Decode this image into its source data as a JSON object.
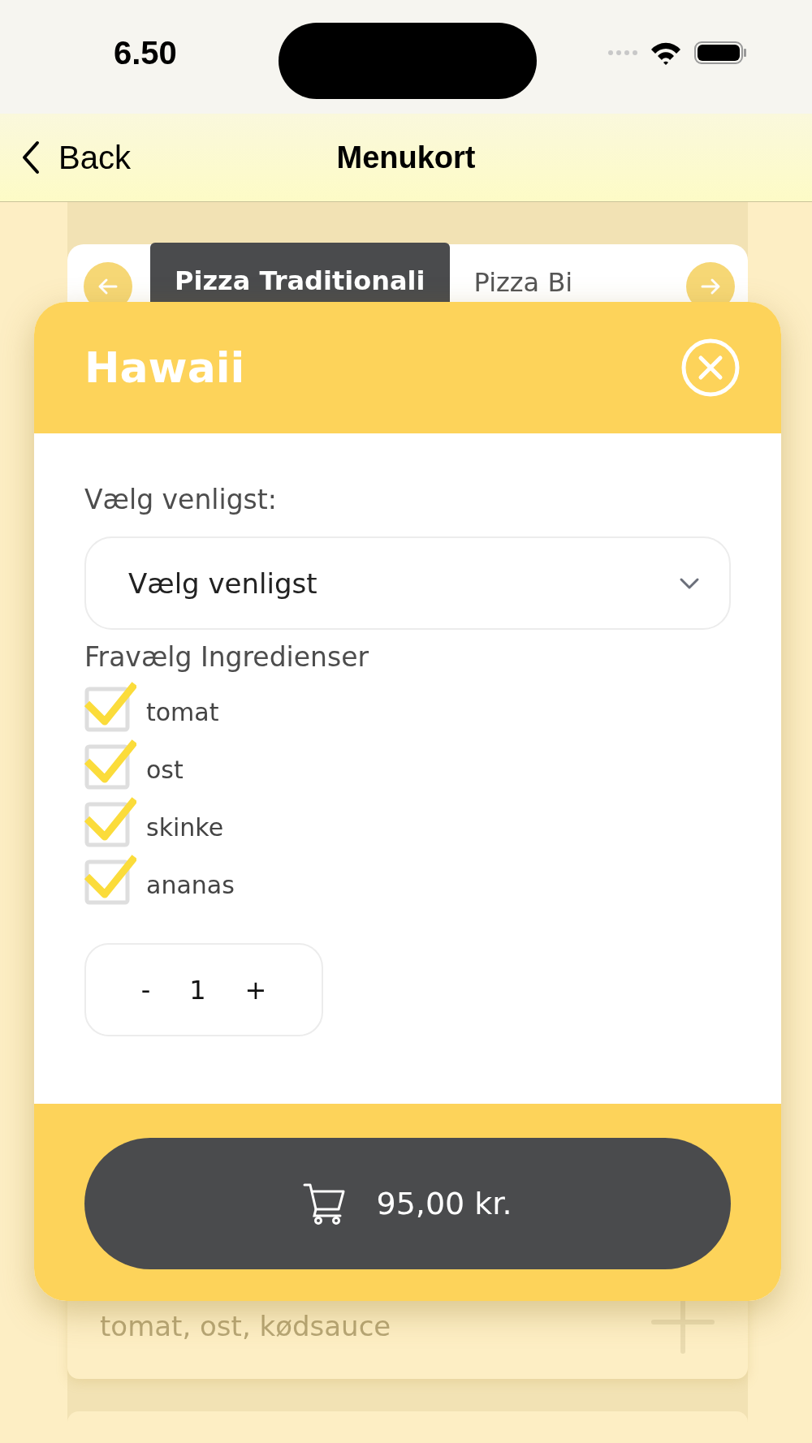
{
  "status_bar": {
    "time": "6.50"
  },
  "nav": {
    "back": "Back",
    "title": "Menukort"
  },
  "category_tabs": [
    {
      "label": "Pizza Traditionali",
      "selected": true
    },
    {
      "label": "Pizza Bi",
      "selected": false
    }
  ],
  "background_item": {
    "description": "tomat, ost, kødsauce"
  },
  "modal": {
    "title": "Hawaii",
    "select_label": "Vælg venligst:",
    "select": {
      "value": "Vælg venligst"
    },
    "ingredients_heading": "Fravælg Ingredienser",
    "ingredients": [
      {
        "label": "tomat",
        "checked": true
      },
      {
        "label": "ost",
        "checked": true
      },
      {
        "label": "skinke",
        "checked": true
      },
      {
        "label": "ananas",
        "checked": true
      }
    ],
    "stepper": {
      "minus": "-",
      "quantity": "1",
      "plus": "+"
    },
    "cart_button": "95,00 kr."
  }
}
